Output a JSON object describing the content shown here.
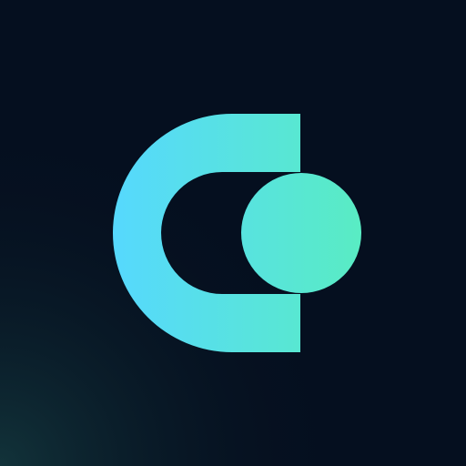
{
  "logo": {
    "name": "app-logo",
    "background_color": "#050f1f",
    "glow_color": "#12333a",
    "gradient_start": "#56d8ff",
    "gradient_end": "#59ecc3"
  }
}
